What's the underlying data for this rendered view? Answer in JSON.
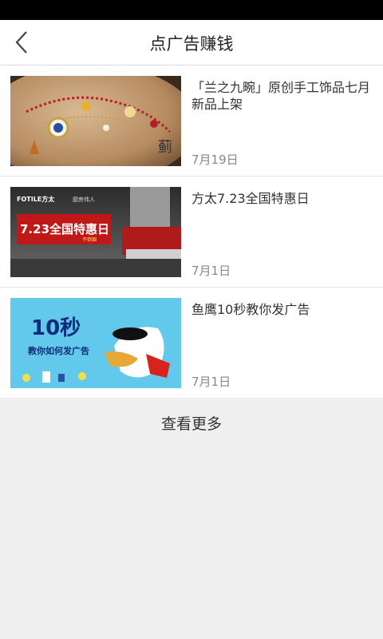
{
  "header": {
    "title": "点广告赚钱",
    "back_icon": "chevron-left-icon"
  },
  "items": [
    {
      "title": "「兰之九畹」原创手工饰品七月新品上架",
      "date": "7月19日"
    },
    {
      "title": "方太7.23全国特惠日",
      "date": "7月1日",
      "thumb": {
        "brand": "FOTILE方太",
        "slogan": "厨房伟人",
        "promo": "7.23全国特惠日",
        "sub": "不倒烟"
      }
    },
    {
      "title": "鱼鹰10秒教你发广告",
      "date": "7月1日",
      "thumb": {
        "big": "10秒",
        "sub": "教你如何发广告"
      }
    }
  ],
  "more_label": "查看更多",
  "colors": {
    "statusbar": "#000000",
    "background": "#efefef",
    "card": "#ffffff",
    "date": "#888888"
  }
}
